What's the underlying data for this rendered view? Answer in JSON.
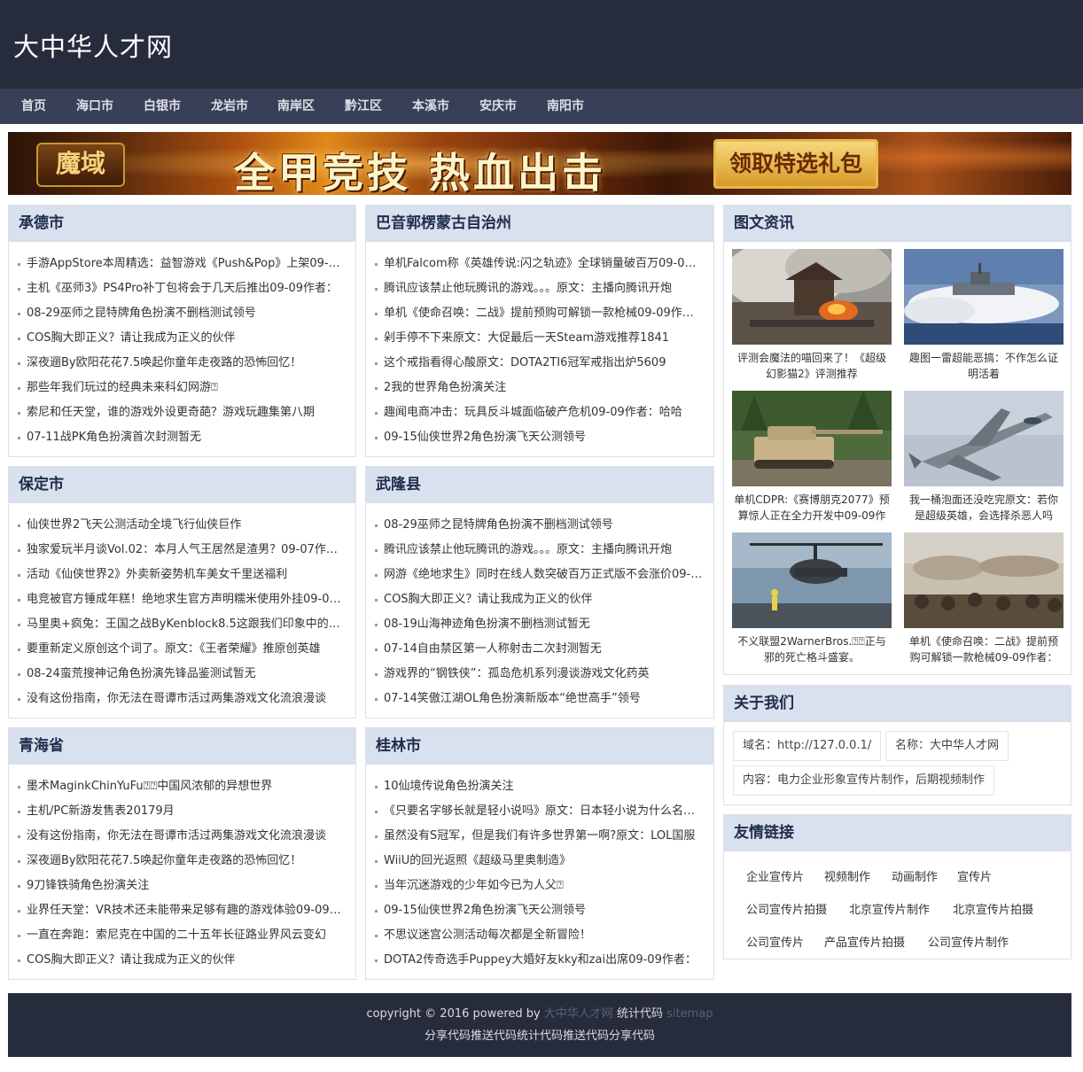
{
  "site": {
    "title": "大中华人才网"
  },
  "nav": [
    "首页",
    "海口市",
    "白银市",
    "龙岩市",
    "南岸区",
    "黔江区",
    "本溪市",
    "安庆市",
    "南阳市"
  ],
  "banner": {
    "logo": "魔域",
    "slogan": "全甲竞技 热血出击",
    "button": "领取特选礼包"
  },
  "sections": [
    {
      "title": "承德市",
      "items": [
        "手游AppStore本周精选：益智游戏《Push&Pop》上架09-09作者：",
        "主机《巫师3》PS4Pro补丁包将会于几天后推出09-09作者：",
        "08-29巫师之昆特牌角色扮演不删档测试领号",
        "COS胸大即正义？请让我成为正义的伙伴",
        "深夜逦By欧阳花花7.5唤起你童年走夜路的恐怖回忆！",
        "那些年我们玩过的经典未来科幻网游⍰",
        "索尼和任天堂，谁的游戏外设更奇葩？游戏玩趣集第八期",
        "07-11战PK角色扮演首次封测暂无"
      ]
    },
    {
      "title": "巴音郭楞蒙古自治州",
      "items": [
        "单机Falcom称《英雄传说:闪之轨迹》全球销量破百万09-09作者：",
        "腾讯应该禁止他玩腾讯的游戏。。。原文：主播向腾讯开炮",
        "单机《使命召唤：二战》提前预购可解锁一款枪械09-09作者：",
        "剁手停不下来原文：大促最后一天Steam游戏推荐1841",
        "这个戒指看得心酸原文：DOTA2TI6冠军戒指出炉5609",
        "2我的世界角色扮演关注",
        "趣闻电商冲击：玩具反斗城面临破产危机09-09作者：哈哈",
        "09-15仙侠世界2角色扮演飞天公测领号"
      ]
    },
    {
      "title": "保定市",
      "items": [
        "仙侠世界2飞天公测活动全境飞行仙侠巨作",
        "独家爱玩半月谈Vol.02：本月人气王居然是渣男？09-07作者：",
        "活动《仙侠世界2》外卖新姿势机车美女千里送福利",
        "电竞被官方锤成年糕！绝地求生官方声明糯米使用外挂09-09作者：",
        "马里奥+疯兔：王国之战ByKenblock8.5这跟我们印象中的马里奥",
        "要重新定义原创这个词了。原文：《王者荣耀》推原创英雄",
        "08-24蛮荒搜神记角色扮演先锋品鉴测试暂无",
        "没有这份指南，你无法在哥谭市活过两集游戏文化流浪漫谈"
      ]
    },
    {
      "title": "武隆县",
      "items": [
        "08-29巫师之昆特牌角色扮演不删档测试领号",
        "腾讯应该禁止他玩腾讯的游戏。。。原文：主播向腾讯开炮",
        "网游《绝地求生》同时在线人数突破百万正式版不会涨价09-09",
        "COS胸大即正义？请让我成为正义的伙伴",
        "08-19山海神迹角色扮演不删档测试暂无",
        "07-14自由禁区第一人称射击二次封测暂无",
        "游戏界的“钢铁侠”：孤岛危机系列漫谈游戏文化药英",
        "07-14笑傲江湖OL角色扮演新版本“绝世高手”领号"
      ]
    },
    {
      "title": "青海省",
      "items": [
        "墨术MaginkChinYuFu⍰⍰中国风浓郁的异想世界",
        "主机/PC新游发售表20179月",
        "没有这份指南，你无法在哥谭市活过两集游戏文化流浪漫谈",
        "深夜逦By欧阳花花7.5唤起你童年走夜路的恐怖回忆！",
        "9刀锋铁骑角色扮演关注",
        "业界任天堂：VR技术还未能带来足够有趣的游戏体验09-09作者：",
        "一直在奔跑：索尼克在中国的二十五年长征路业界风云变幻",
        "COS胸大即正义？请让我成为正义的伙伴"
      ]
    },
    {
      "title": "桂林市",
      "items": [
        "10仙境传说角色扮演关注",
        "《只要名字够长就是轻小说吗》原文：日本轻小说为什么名字那么长",
        "虽然没有S冠军，但是我们有许多世界第一啊?原文：LOL国服",
        "WiiU的回光返照《超级马里奥制造》",
        "当年沉迷游戏的少年如今已为人父⍰",
        "09-15仙侠世界2角色扮演飞天公测领号",
        "不思议迷宫公测活动每次都是全新冒险！",
        "DOTA2传奇选手Puppey大婚好友kky和zai出席09-09作者："
      ]
    }
  ],
  "pictures": {
    "title": "图文资讯",
    "items": [
      {
        "caption": "评测会魔法的喵回来了！《超级幻影猫2》评测推荐",
        "image": "battlefield-smoke"
      },
      {
        "caption": "趣图一雷超能恶搞：不作怎么证明活着",
        "image": "hovercraft-at-sea"
      },
      {
        "caption": "单机CDPR:《赛博朋克2077》预算惊人正在全力开发中09-09作者：",
        "image": "tank-in-forest"
      },
      {
        "caption": "我一桶泡面还没吃完原文：若你是超级英雄，会选择杀恶人吗",
        "image": "fighter-jet"
      },
      {
        "caption": "不义联盟2WarnerBros.⍰⍰正与邪的死亡格斗盛宴。",
        "image": "helicopter-on-deck"
      },
      {
        "caption": "单机《使命召唤：二战》提前预购可解锁一款枪械09-09作者：霍",
        "image": "soldiers-on-hill"
      }
    ]
  },
  "about": {
    "title": "关于我们",
    "domain": "域名：http://127.0.0.1/",
    "name": "名称：大中华人才网",
    "content": "内容：电力企业形象宣传片制作，后期视频制作"
  },
  "links": {
    "title": "友情链接",
    "items": [
      "企业宣传片",
      "视频制作",
      "动画制作",
      "宣传片",
      "公司宣传片拍摄",
      "北京宣传片制作",
      "北京宣传片拍摄",
      "公司宣传片",
      "产品宣传片拍摄",
      "公司宣传片制作"
    ]
  },
  "footer": {
    "copyright": "copyright © 2016 powered by",
    "site_link": "大中华人才网",
    "stats": "统计代码",
    "sitemap": "sitemap",
    "line2": "分享代码推送代码统计代码推送代码分享代码"
  }
}
